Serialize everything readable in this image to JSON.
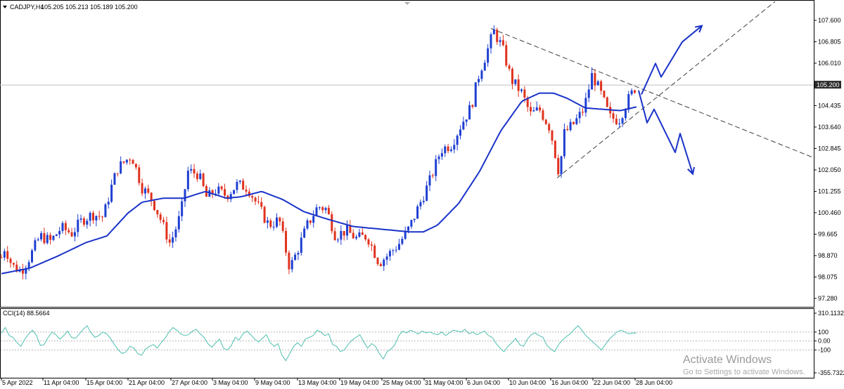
{
  "header": {
    "symbol": "CADJPY,H4",
    "ohlc": "105.205 105.213 105.189 105.200"
  },
  "cci_header": {
    "label": "CCI(14) 88.5664"
  },
  "chart_data": [
    {
      "type": "line",
      "title": "CADJPY,H4",
      "chart_style": "candlestick",
      "price_ticks": [
        "107.600",
        "106.805",
        "106.010",
        "105.215",
        "104.435",
        "103.640",
        "102.845",
        "102.050",
        "101.255",
        "100.460",
        "99.665",
        "98.870",
        "98.075",
        "97.280"
      ],
      "current_price": "105.200",
      "ylim": [
        97.0,
        108.0
      ],
      "x_labels": [
        "5 Apr 2022",
        "11 Apr 04:00",
        "15 Apr 04:00",
        "21 Apr 04:00",
        "27 Apr 04:00",
        "3 May 04:00",
        "9 May 04:00",
        "13 May 04:00",
        "19 May 04:00",
        "25 May 04:00",
        "31 May 04:00",
        "6 Jun 04:00",
        "10 Jun 04:00",
        "16 Jun 04:00",
        "22 Jun 04:00",
        "28 Jun 04:00"
      ],
      "colors": {
        "bull": "#1f3fd1",
        "bear": "#e0321e",
        "ma": "#1a33c8",
        "annotation": "#1a33c8",
        "trendline": "#404040"
      },
      "price_path": [
        {
          "t": 0,
          "p": 98.8
        },
        {
          "t": 5,
          "p": 99.2
        },
        {
          "t": 15,
          "p": 98.5
        },
        {
          "t": 28,
          "p": 98.3
        },
        {
          "t": 40,
          "p": 98.8
        },
        {
          "t": 55,
          "p": 99.6
        },
        {
          "t": 70,
          "p": 99.4
        },
        {
          "t": 85,
          "p": 99.9
        },
        {
          "t": 100,
          "p": 99.7
        },
        {
          "t": 115,
          "p": 100.2
        },
        {
          "t": 130,
          "p": 100.4
        },
        {
          "t": 145,
          "p": 100.3
        },
        {
          "t": 155,
          "p": 101.3
        },
        {
          "t": 165,
          "p": 102.1
        },
        {
          "t": 185,
          "p": 102.6
        },
        {
          "t": 200,
          "p": 101.4
        },
        {
          "t": 215,
          "p": 100.9
        },
        {
          "t": 225,
          "p": 100.3
        },
        {
          "t": 240,
          "p": 99.3
        },
        {
          "t": 255,
          "p": 100.4
        },
        {
          "t": 265,
          "p": 102.0
        },
        {
          "t": 280,
          "p": 101.9
        },
        {
          "t": 292,
          "p": 101.0
        },
        {
          "t": 305,
          "p": 101.3
        },
        {
          "t": 320,
          "p": 101.1
        },
        {
          "t": 335,
          "p": 101.5
        },
        {
          "t": 350,
          "p": 101.4
        },
        {
          "t": 365,
          "p": 100.7
        },
        {
          "t": 380,
          "p": 100.0
        },
        {
          "t": 395,
          "p": 100.2
        },
        {
          "t": 410,
          "p": 98.4
        },
        {
          "t": 420,
          "p": 99.0
        },
        {
          "t": 435,
          "p": 100.0
        },
        {
          "t": 450,
          "p": 100.7
        },
        {
          "t": 462,
          "p": 100.6
        },
        {
          "t": 475,
          "p": 99.6
        },
        {
          "t": 490,
          "p": 99.8
        },
        {
          "t": 505,
          "p": 99.5
        },
        {
          "t": 520,
          "p": 99.6
        },
        {
          "t": 537,
          "p": 98.6
        },
        {
          "t": 550,
          "p": 98.9
        },
        {
          "t": 565,
          "p": 99.3
        },
        {
          "t": 580,
          "p": 99.9
        },
        {
          "t": 595,
          "p": 100.8
        },
        {
          "t": 610,
          "p": 101.7
        },
        {
          "t": 625,
          "p": 102.8
        },
        {
          "t": 640,
          "p": 103.0
        },
        {
          "t": 655,
          "p": 103.8
        },
        {
          "t": 668,
          "p": 104.4
        },
        {
          "t": 680,
          "p": 105.7
        },
        {
          "t": 690,
          "p": 106.4
        },
        {
          "t": 700,
          "p": 107.2
        },
        {
          "t": 712,
          "p": 106.6
        },
        {
          "t": 725,
          "p": 105.4
        },
        {
          "t": 740,
          "p": 104.9
        },
        {
          "t": 752,
          "p": 104.1
        },
        {
          "t": 765,
          "p": 104.3
        },
        {
          "t": 780,
          "p": 103.6
        },
        {
          "t": 793,
          "p": 101.9
        },
        {
          "t": 800,
          "p": 103.4
        },
        {
          "t": 815,
          "p": 103.8
        },
        {
          "t": 828,
          "p": 104.3
        },
        {
          "t": 840,
          "p": 105.6
        },
        {
          "t": 852,
          "p": 104.9
        },
        {
          "t": 865,
          "p": 104.0
        },
        {
          "t": 878,
          "p": 103.9
        },
        {
          "t": 890,
          "p": 104.6
        },
        {
          "t": 903,
          "p": 105.2
        }
      ],
      "moving_average": [
        {
          "t": 0,
          "p": 98.2
        },
        {
          "t": 40,
          "p": 98.4
        },
        {
          "t": 80,
          "p": 98.85
        },
        {
          "t": 120,
          "p": 99.35
        },
        {
          "t": 150,
          "p": 99.6
        },
        {
          "t": 180,
          "p": 100.45
        },
        {
          "t": 200,
          "p": 100.85
        },
        {
          "t": 230,
          "p": 101.0
        },
        {
          "t": 260,
          "p": 101.0
        },
        {
          "t": 290,
          "p": 101.25
        },
        {
          "t": 320,
          "p": 101.0
        },
        {
          "t": 340,
          "p": 101.05
        },
        {
          "t": 370,
          "p": 101.25
        },
        {
          "t": 400,
          "p": 100.95
        },
        {
          "t": 430,
          "p": 100.5
        },
        {
          "t": 460,
          "p": 100.25
        },
        {
          "t": 500,
          "p": 99.95
        },
        {
          "t": 540,
          "p": 99.85
        },
        {
          "t": 580,
          "p": 99.75
        },
        {
          "t": 600,
          "p": 99.75
        },
        {
          "t": 620,
          "p": 100.0
        },
        {
          "t": 650,
          "p": 100.8
        },
        {
          "t": 680,
          "p": 102.0
        },
        {
          "t": 710,
          "p": 103.5
        },
        {
          "t": 740,
          "p": 104.6
        },
        {
          "t": 765,
          "p": 104.9
        },
        {
          "t": 785,
          "p": 104.9
        },
        {
          "t": 805,
          "p": 104.7
        },
        {
          "t": 830,
          "p": 104.35
        },
        {
          "t": 855,
          "p": 104.3
        },
        {
          "t": 880,
          "p": 104.25
        },
        {
          "t": 905,
          "p": 104.4
        }
      ],
      "trendlines": [
        {
          "from": {
            "t": 696,
            "p": 107.3
          },
          "to": {
            "t": 1155,
            "p": 102.5
          },
          "style": "dashed"
        },
        {
          "from": {
            "t": 790,
            "p": 101.75
          },
          "to": {
            "t": 1100,
            "p": 108.3
          },
          "style": "dashed"
        }
      ],
      "horizontal_line": 105.2,
      "annotations": [
        {
          "direction": "up",
          "points": [
            {
              "t": 910,
              "p": 104.85
            },
            {
              "t": 930,
              "p": 106.0
            },
            {
              "t": 938,
              "p": 105.5
            },
            {
              "t": 968,
              "p": 106.8
            },
            {
              "t": 996,
              "p": 107.4
            }
          ]
        },
        {
          "direction": "down",
          "points": [
            {
              "t": 906,
              "p": 105.0
            },
            {
              "t": 918,
              "p": 103.8
            },
            {
              "t": 928,
              "p": 104.3
            },
            {
              "t": 958,
              "p": 102.7
            },
            {
              "t": 965,
              "p": 103.4
            },
            {
              "t": 983,
              "p": 101.9
            }
          ]
        }
      ]
    },
    {
      "type": "line",
      "title": "CCI(14) 88.5664",
      "ticks": [
        "310.1132",
        "100",
        "0.00",
        "-100",
        "-355.7322"
      ],
      "ylim": [
        -355.7322,
        310.1132
      ],
      "color": "#4fbfb0",
      "values": [
        85,
        150,
        60,
        40,
        -20,
        -60,
        20,
        80,
        120,
        60,
        -50,
        -40,
        40,
        100,
        70,
        20,
        60,
        110,
        40,
        30,
        80,
        130,
        170,
        90,
        40,
        60,
        100,
        80,
        30,
        -40,
        -100,
        -140,
        -120,
        -60,
        -80,
        -140,
        -160,
        -90,
        -60,
        -40,
        -80,
        -20,
        30,
        100,
        150,
        120,
        80,
        60,
        70,
        110,
        130,
        80,
        40,
        -30,
        -70,
        -20,
        20,
        -80,
        -100,
        -50,
        40,
        10,
        80,
        110,
        70,
        20,
        -10,
        30,
        70,
        -20,
        -60,
        -30,
        -160,
        -220,
        -140,
        -60,
        -20,
        -60,
        20,
        40,
        60,
        120,
        100,
        60,
        80,
        -40,
        -60,
        -120,
        -100,
        -40,
        10,
        40,
        70,
        -10,
        -80,
        -30,
        -60,
        -140,
        -200,
        -120,
        -90,
        -40,
        60,
        110,
        90,
        120,
        100,
        80,
        110,
        90,
        100,
        80,
        70,
        100,
        60,
        90,
        120,
        110,
        100,
        130,
        80,
        100,
        70,
        90,
        110,
        60,
        40,
        -30,
        -80,
        -120,
        -60,
        -20,
        30,
        -40,
        -60,
        20,
        70,
        90,
        60,
        40,
        -50,
        -90,
        -120,
        -40,
        10,
        50,
        80,
        130,
        170,
        120,
        60,
        20,
        -20,
        -60,
        -100,
        -40,
        20,
        60,
        100,
        120,
        100,
        80,
        90,
        88.5664
      ]
    }
  ],
  "watermark": {
    "title": "Activate Windows",
    "subtitle": "Go to Settings to activate Windows."
  }
}
